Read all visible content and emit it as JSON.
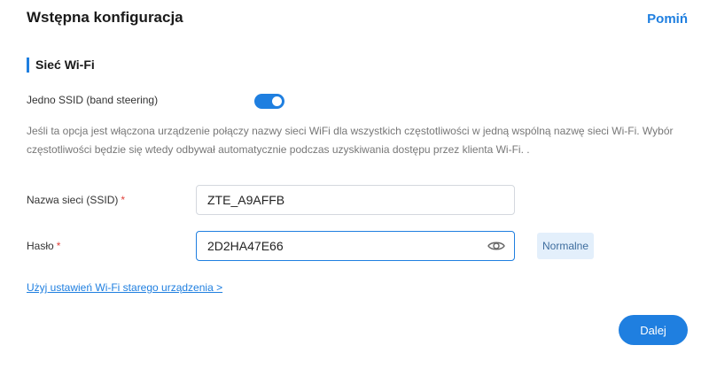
{
  "header": {
    "title": "Wstępna konfiguracja",
    "skip_label": "Pomiń"
  },
  "section": {
    "title": "Sieć Wi-Fi"
  },
  "single_ssid": {
    "label": "Jedno SSID (band steering)",
    "enabled": true,
    "description": "Jeśli ta opcja jest włączona urządzenie połączy nazwy sieci WiFi dla wszystkich częstotliwości w jedną wspólną nazwę sieci Wi-Fi. Wybór częstotliwości będzie się wtedy odbywał automatycznie podczas uzyskiwania dostępu przez klienta Wi-Fi. ."
  },
  "ssid_field": {
    "label": "Nazwa sieci (SSID)",
    "required_mark": "*",
    "value": "ZTE_A9AFFB"
  },
  "password_field": {
    "label": "Hasło",
    "required_mark": "*",
    "value": "2D2HA47E66",
    "visibility_icon": "eye-icon",
    "strength": "Normalne"
  },
  "old_settings_link": "Użyj ustawień Wi-Fi starego urządzenia >",
  "next_button_label": "Dalej",
  "colors": {
    "accent": "#1f7fe0",
    "required": "#e0413b",
    "strength_bg": "#e3effb"
  }
}
